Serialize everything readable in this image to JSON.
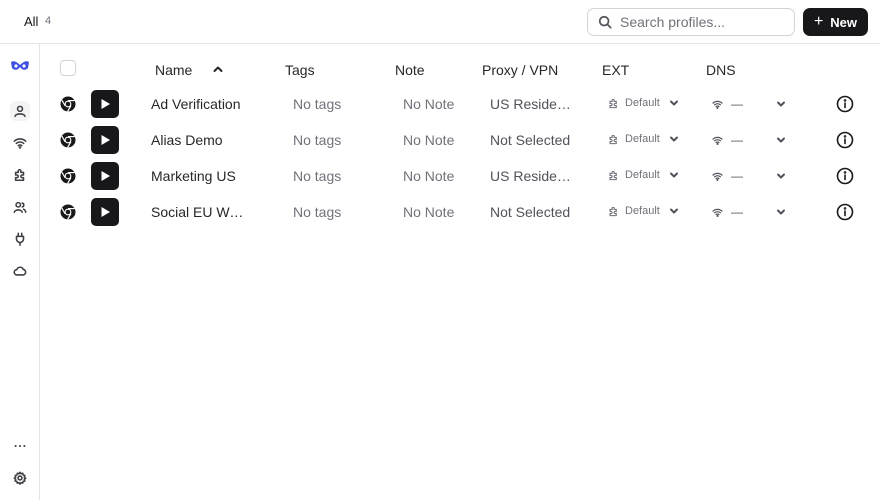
{
  "topbar": {
    "filter_label": "All",
    "filter_count": "4",
    "search_placeholder": "Search profiles...",
    "new_button_label": "New"
  },
  "sidebar": {
    "items": [
      "logo-icon",
      "profiles-icon",
      "proxy-icon",
      "extensions-icon",
      "team-icon",
      "plug-icon",
      "cloud-icon",
      "more-icon",
      "settings-icon"
    ]
  },
  "table": {
    "columns": [
      "Name",
      "Tags",
      "Note",
      "Proxy / VPN",
      "EXT",
      "DNS"
    ],
    "sort": {
      "column": "Name",
      "direction": "ascending"
    },
    "rows": [
      {
        "name": "Ad Verification",
        "tags": "No tags",
        "note": "No Note",
        "proxy": "US Residential",
        "ext": "Default",
        "dns": "—"
      },
      {
        "name": "Alias Demo",
        "tags": "No tags",
        "note": "No Note",
        "proxy": "Not Selected",
        "ext": "Default",
        "dns": "—"
      },
      {
        "name": "Marketing US",
        "tags": "No tags",
        "note": "No Note",
        "proxy": "US Residential",
        "ext": "Default",
        "dns": "—"
      },
      {
        "name": "Social EU West",
        "tags": "No tags",
        "note": "No Note",
        "proxy": "Not Selected",
        "ext": "Default",
        "dns": "—"
      }
    ]
  },
  "colors": {
    "primary": "#18181b",
    "border": "#e4e4e7",
    "muted_text": "#71717a",
    "logo": "#3b4fe0"
  }
}
